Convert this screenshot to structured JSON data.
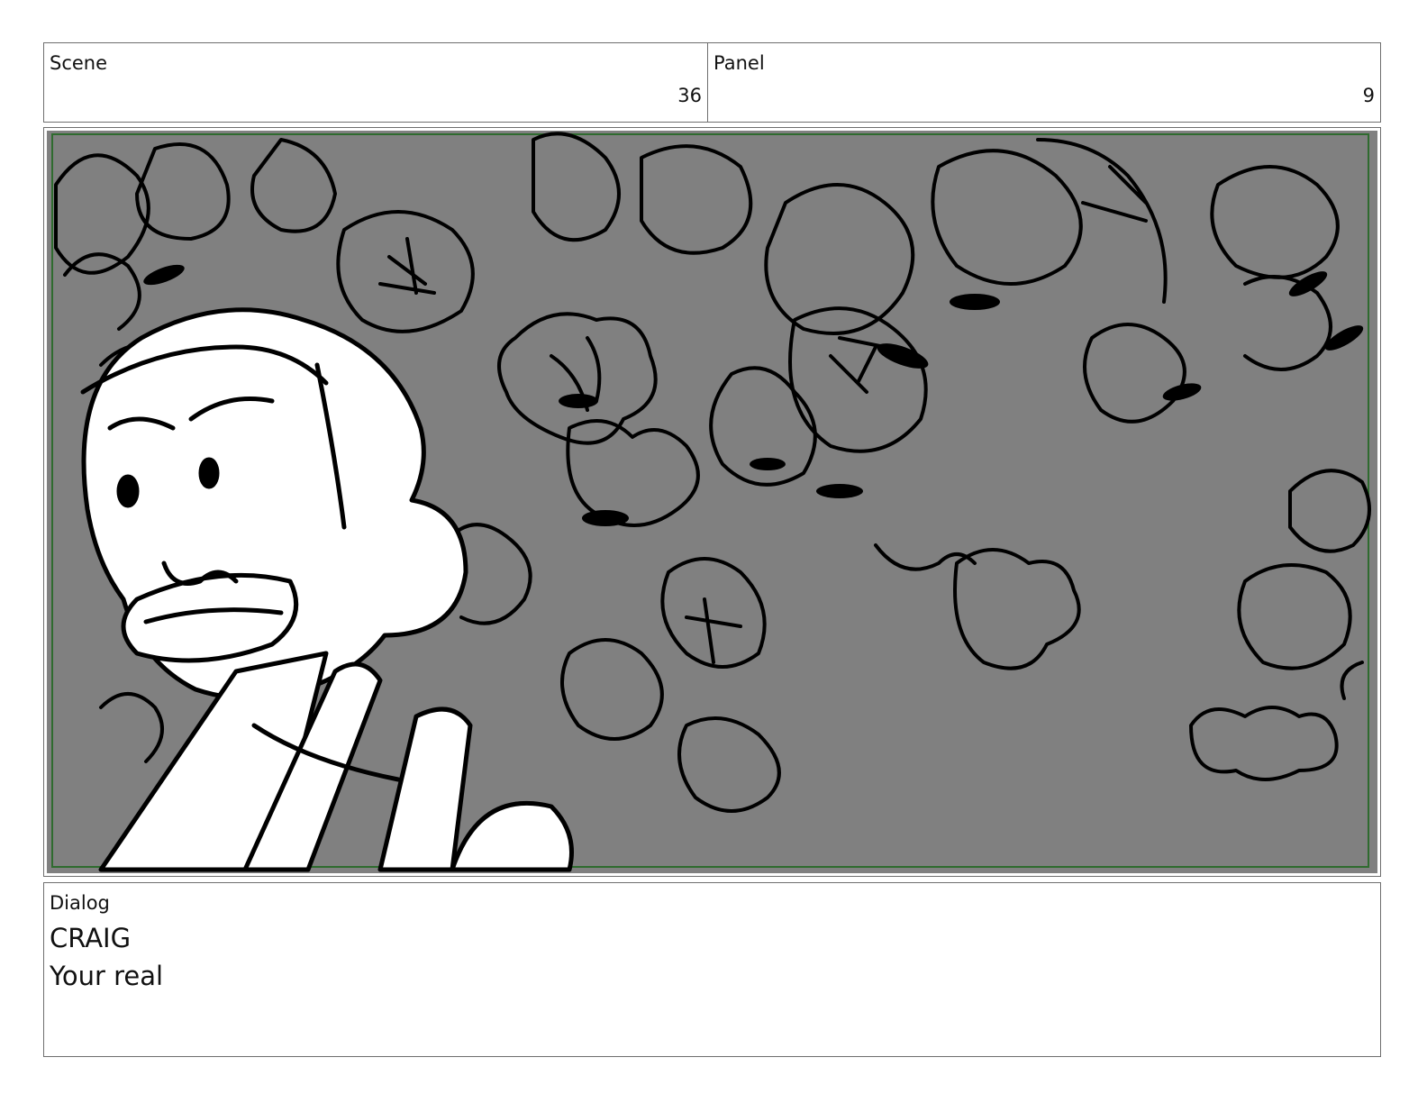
{
  "header": {
    "scene_label": "Scene",
    "scene_value": "36",
    "panel_label": "Panel",
    "panel_value": "9"
  },
  "panel_image": {
    "background_color": "#808080",
    "frame_color": "#2f6b2f"
  },
  "dialog": {
    "label": "Dialog",
    "character": "CRAIG",
    "line": "Your real"
  }
}
